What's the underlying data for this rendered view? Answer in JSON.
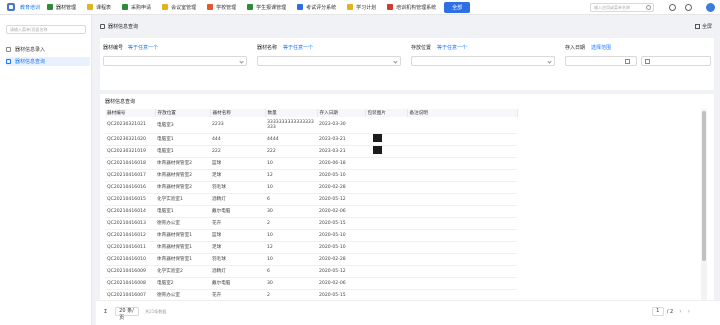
{
  "app_title": "教育培训",
  "nav_tabs": [
    {
      "label": "器材管理",
      "color": "#2e8b3a"
    },
    {
      "label": "课程表",
      "color": "#e2b21f"
    },
    {
      "label": "采购申请",
      "color": "#2e8b3a"
    },
    {
      "label": "会议室管理",
      "color": "#e2b21f"
    },
    {
      "label": "学校管理",
      "color": "#e05a2a"
    },
    {
      "label": "学生报课管理",
      "color": "#2e8b3a"
    },
    {
      "label": "考试评分系统",
      "color": "#2d6fe0"
    },
    {
      "label": "学习计划",
      "color": "#e2b21f"
    },
    {
      "label": "培训机构管理系统",
      "color": "#d23b2b"
    }
  ],
  "nav_all_label": "全部",
  "search_placeholder": "输入应用或菜单名称",
  "sidebar": {
    "search_placeholder": "请输入菜单/页面名称",
    "items": [
      {
        "label": "器材信息录入"
      },
      {
        "label": "器材信息查询"
      }
    ]
  },
  "breadcrumb": "器材信息查询",
  "fullscreen_label": "全屏",
  "filters": [
    {
      "label": "器材编号",
      "select": "等于任意一个"
    },
    {
      "label": "器材名称",
      "select": "等于任意一个"
    },
    {
      "label": "存放位置",
      "select": "等于任意一个"
    },
    {
      "label": "存入日期",
      "select": "选择范围"
    }
  ],
  "table": {
    "title": "器材信息查询",
    "columns": [
      "器材编号",
      "存放位置",
      "器材名称",
      "数量",
      "存入日期",
      "包装图片",
      "备注说明"
    ],
    "rows": [
      [
        "QC20230321021",
        "电脑室3",
        "2233",
        "3333333333333333333",
        "2023-03-30",
        "",
        ""
      ],
      [
        "QC20230321020",
        "电脑室1",
        "444",
        "4444",
        "2023-03-21",
        "image",
        ""
      ],
      [
        "QC20230321019",
        "电脑室1",
        "222",
        "222",
        "2023-03-21",
        "image",
        ""
      ],
      [
        "QC20210416018",
        "体育器材保管室2",
        "篮球",
        "10",
        "2020-06-18",
        "",
        ""
      ],
      [
        "QC20210416017",
        "体育器材保管室2",
        "足球",
        "12",
        "2020-05-10",
        "",
        ""
      ],
      [
        "QC20210416016",
        "体育器材保管室2",
        "羽毛球",
        "10",
        "2020-02-28",
        "",
        ""
      ],
      [
        "QC20210416015",
        "化学实验室1",
        "酒精灯",
        "6",
        "2020-05-12",
        "",
        ""
      ],
      [
        "QC20210416014",
        "电脑室1",
        "戴尔电脑",
        "30",
        "2020-02-06",
        "",
        ""
      ],
      [
        "QC20210416013",
        "德育办公室",
        "花卉",
        "2",
        "2020-05-15",
        "",
        ""
      ],
      [
        "QC20210416012",
        "体育器材保管室1",
        "篮球",
        "10",
        "2020-05-10",
        "",
        ""
      ],
      [
        "QC20210416011",
        "体育器材保管室1",
        "足球",
        "12",
        "2020-05-10",
        "",
        ""
      ],
      [
        "QC20210416010",
        "体育器材保管室1",
        "羽毛球",
        "10",
        "2020-02-28",
        "",
        ""
      ],
      [
        "QC20210416009",
        "化学实验室2",
        "酒精灯",
        "6",
        "2020-05-12",
        "",
        ""
      ],
      [
        "QC20210416008",
        "电脑室2",
        "戴尔电脑",
        "30",
        "2020-02-06",
        "",
        ""
      ],
      [
        "QC20210416007",
        "德育办公室",
        "花卉",
        "2",
        "2020-05-15",
        "",
        ""
      ]
    ]
  },
  "pager": {
    "page_size": "20 条/页",
    "total": "共21条数据",
    "current": "1",
    "total_pages": "/ 2"
  }
}
